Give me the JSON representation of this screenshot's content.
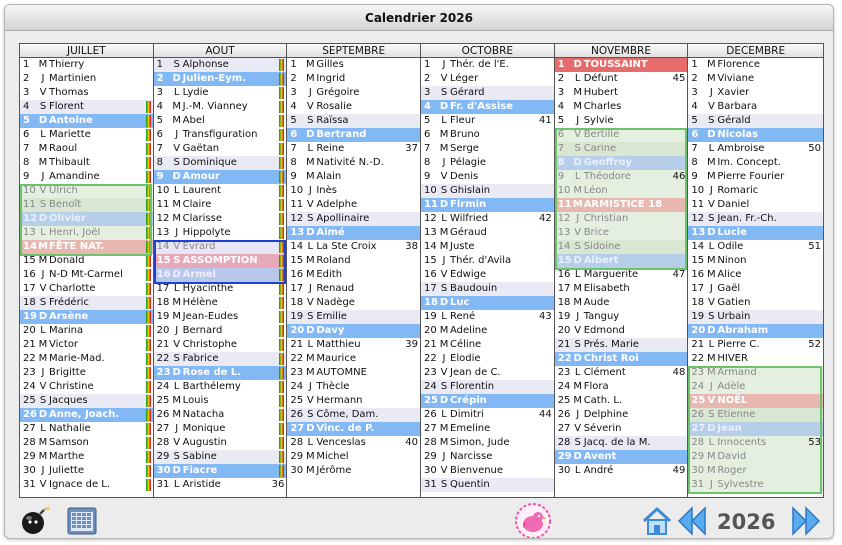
{
  "window": {
    "title": "Calendrier 2026"
  },
  "footer": {
    "year": "2026"
  },
  "icons": {
    "bomb": "bomb-icon",
    "calendar": "calendar-grid-icon",
    "mascot": "pink-bird-mascot-icon",
    "home": "home-icon",
    "prev": "double-chevron-left-icon",
    "next": "double-chevron-right-icon"
  },
  "months": [
    {
      "name": "JUILLET",
      "days": [
        [
          "1",
          "M",
          "Thierry",
          ""
        ],
        [
          "2",
          "J",
          "Martinien",
          ""
        ],
        [
          "3",
          "V",
          "Thomas",
          ""
        ],
        [
          "4",
          "S",
          "Florent",
          ""
        ],
        [
          "5",
          "D",
          "Antoine",
          ""
        ],
        [
          "6",
          "L",
          "Mariette",
          ""
        ],
        [
          "7",
          "M",
          "Raoul",
          ""
        ],
        [
          "8",
          "M",
          "Thibault",
          ""
        ],
        [
          "9",
          "J",
          "Amandine",
          ""
        ],
        [
          "10",
          "V",
          "Ulrich",
          ""
        ],
        [
          "11",
          "S",
          "Benoît",
          ""
        ],
        [
          "12",
          "D",
          "Olivier",
          ""
        ],
        [
          "13",
          "L",
          "Henri, Joël",
          ""
        ],
        [
          "14",
          "M",
          "FÊTE NAT.",
          ""
        ],
        [
          "15",
          "M",
          "Donald",
          ""
        ],
        [
          "16",
          "J",
          "N-D Mt-Carmel",
          ""
        ],
        [
          "17",
          "V",
          "Charlotte",
          ""
        ],
        [
          "18",
          "S",
          "Frédéric",
          ""
        ],
        [
          "19",
          "D",
          "Arsène",
          ""
        ],
        [
          "20",
          "L",
          "Marina",
          ""
        ],
        [
          "21",
          "M",
          "Victor",
          ""
        ],
        [
          "22",
          "M",
          "Marie-Mad.",
          ""
        ],
        [
          "23",
          "J",
          "Brigitte",
          ""
        ],
        [
          "24",
          "V",
          "Christine",
          ""
        ],
        [
          "25",
          "S",
          "Jacques",
          ""
        ],
        [
          "26",
          "D",
          "Anne, Joach.",
          ""
        ],
        [
          "27",
          "L",
          "Nathalie",
          ""
        ],
        [
          "28",
          "M",
          "Samson",
          ""
        ],
        [
          "29",
          "M",
          "Marthe",
          ""
        ],
        [
          "30",
          "J",
          "Juliette",
          ""
        ],
        [
          "31",
          "V",
          "Ignace de L.",
          ""
        ]
      ]
    },
    {
      "name": "AOUT",
      "days": [
        [
          "1",
          "S",
          "Alphonse",
          ""
        ],
        [
          "2",
          "D",
          "Julien-Eym.",
          ""
        ],
        [
          "3",
          "L",
          "Lydie",
          ""
        ],
        [
          "4",
          "M",
          "J.-M. Vianney",
          ""
        ],
        [
          "5",
          "M",
          "Abel",
          ""
        ],
        [
          "6",
          "J",
          "Transfiguration",
          ""
        ],
        [
          "7",
          "V",
          "Gaëtan",
          ""
        ],
        [
          "8",
          "S",
          "Dominique",
          ""
        ],
        [
          "9",
          "D",
          "Amour",
          ""
        ],
        [
          "10",
          "L",
          "Laurent",
          ""
        ],
        [
          "11",
          "M",
          "Claire",
          ""
        ],
        [
          "12",
          "M",
          "Clarisse",
          ""
        ],
        [
          "13",
          "J",
          "Hippolyte",
          ""
        ],
        [
          "14",
          "V",
          "Evrard",
          ""
        ],
        [
          "15",
          "S",
          "ASSOMPTION",
          ""
        ],
        [
          "16",
          "D",
          "Armel",
          ""
        ],
        [
          "17",
          "L",
          "Hyacinthe",
          ""
        ],
        [
          "18",
          "M",
          "Hélène",
          ""
        ],
        [
          "19",
          "M",
          "Jean-Eudes",
          ""
        ],
        [
          "20",
          "J",
          "Bernard",
          ""
        ],
        [
          "21",
          "V",
          "Christophe",
          ""
        ],
        [
          "22",
          "S",
          "Fabrice",
          ""
        ],
        [
          "23",
          "D",
          "Rose de L.",
          ""
        ],
        [
          "24",
          "L",
          "Barthélemy",
          ""
        ],
        [
          "25",
          "M",
          "Louis",
          ""
        ],
        [
          "26",
          "M",
          "Natacha",
          ""
        ],
        [
          "27",
          "J",
          "Monique",
          ""
        ],
        [
          "28",
          "V",
          "Augustin",
          ""
        ],
        [
          "29",
          "S",
          "Sabine",
          ""
        ],
        [
          "30",
          "D",
          "Fiacre",
          ""
        ],
        [
          "31",
          "L",
          "Aristide",
          "36"
        ]
      ]
    },
    {
      "name": "SEPTEMBRE",
      "days": [
        [
          "1",
          "M",
          "Gilles",
          ""
        ],
        [
          "2",
          "M",
          "Ingrid",
          ""
        ],
        [
          "3",
          "J",
          "Grégoire",
          ""
        ],
        [
          "4",
          "V",
          "Rosalie",
          ""
        ],
        [
          "5",
          "S",
          "Raïssa",
          ""
        ],
        [
          "6",
          "D",
          "Bertrand",
          ""
        ],
        [
          "7",
          "L",
          "Reine",
          "37"
        ],
        [
          "8",
          "M",
          "Nativité N.-D.",
          ""
        ],
        [
          "9",
          "M",
          "Alain",
          ""
        ],
        [
          "10",
          "J",
          "Inès",
          ""
        ],
        [
          "11",
          "V",
          "Adelphe",
          ""
        ],
        [
          "12",
          "S",
          "Apollinaire",
          ""
        ],
        [
          "13",
          "D",
          "Aimé",
          ""
        ],
        [
          "14",
          "L",
          "La Ste Croix",
          "38"
        ],
        [
          "15",
          "M",
          "Roland",
          ""
        ],
        [
          "16",
          "M",
          "Edith",
          ""
        ],
        [
          "17",
          "J",
          "Renaud",
          ""
        ],
        [
          "18",
          "V",
          "Nadège",
          ""
        ],
        [
          "19",
          "S",
          "Emilie",
          ""
        ],
        [
          "20",
          "D",
          "Davy",
          ""
        ],
        [
          "21",
          "L",
          "Matthieu",
          "39"
        ],
        [
          "22",
          "M",
          "Maurice",
          ""
        ],
        [
          "23",
          "M",
          "AUTOMNE",
          ""
        ],
        [
          "24",
          "J",
          "Thècle",
          ""
        ],
        [
          "25",
          "V",
          "Hermann",
          ""
        ],
        [
          "26",
          "S",
          "Côme, Dam.",
          ""
        ],
        [
          "27",
          "D",
          "Vinc. de P.",
          ""
        ],
        [
          "28",
          "L",
          "Venceslas",
          "40"
        ],
        [
          "29",
          "M",
          "Michel",
          ""
        ],
        [
          "30",
          "M",
          "Jérôme",
          ""
        ]
      ]
    },
    {
      "name": "OCTOBRE",
      "days": [
        [
          "1",
          "J",
          "Thér. de l'E.",
          ""
        ],
        [
          "2",
          "V",
          "Léger",
          ""
        ],
        [
          "3",
          "S",
          "Gérard",
          ""
        ],
        [
          "4",
          "D",
          "Fr. d'Assise",
          ""
        ],
        [
          "5",
          "L",
          "Fleur",
          "41"
        ],
        [
          "6",
          "M",
          "Bruno",
          ""
        ],
        [
          "7",
          "M",
          "Serge",
          ""
        ],
        [
          "8",
          "J",
          "Pélagie",
          ""
        ],
        [
          "9",
          "V",
          "Denis",
          ""
        ],
        [
          "10",
          "S",
          "Ghislain",
          ""
        ],
        [
          "11",
          "D",
          "Firmin",
          ""
        ],
        [
          "12",
          "L",
          "Wilfried",
          "42"
        ],
        [
          "13",
          "M",
          "Géraud",
          ""
        ],
        [
          "14",
          "M",
          "Juste",
          ""
        ],
        [
          "15",
          "J",
          "Thér. d'Avila",
          ""
        ],
        [
          "16",
          "V",
          "Edwige",
          ""
        ],
        [
          "17",
          "S",
          "Baudouin",
          ""
        ],
        [
          "18",
          "D",
          "Luc",
          ""
        ],
        [
          "19",
          "L",
          "René",
          "43"
        ],
        [
          "20",
          "M",
          "Adeline",
          ""
        ],
        [
          "21",
          "M",
          "Céline",
          ""
        ],
        [
          "22",
          "J",
          "Elodie",
          ""
        ],
        [
          "23",
          "V",
          "Jean de C.",
          ""
        ],
        [
          "24",
          "S",
          "Florentin",
          ""
        ],
        [
          "25",
          "D",
          "Crépin",
          ""
        ],
        [
          "26",
          "L",
          "Dimitri",
          "44"
        ],
        [
          "27",
          "M",
          "Emeline",
          ""
        ],
        [
          "28",
          "M",
          "Simon, Jude",
          ""
        ],
        [
          "29",
          "J",
          "Narcisse",
          ""
        ],
        [
          "30",
          "V",
          "Bienvenue",
          ""
        ],
        [
          "31",
          "S",
          "Quentin",
          ""
        ]
      ]
    },
    {
      "name": "NOVEMBRE",
      "days": [
        [
          "1",
          "D",
          "TOUSSAINT",
          ""
        ],
        [
          "2",
          "L",
          "Défunt",
          "45"
        ],
        [
          "3",
          "M",
          "Hubert",
          ""
        ],
        [
          "4",
          "M",
          "Charles",
          ""
        ],
        [
          "5",
          "J",
          "Sylvie",
          ""
        ],
        [
          "6",
          "V",
          "Bertille",
          ""
        ],
        [
          "7",
          "S",
          "Carine",
          ""
        ],
        [
          "8",
          "D",
          "Geoffroy",
          ""
        ],
        [
          "9",
          "L",
          "Théodore",
          "46"
        ],
        [
          "10",
          "M",
          "Léon",
          ""
        ],
        [
          "11",
          "M",
          "ARMISTICE 18",
          ""
        ],
        [
          "12",
          "J",
          "Christian",
          ""
        ],
        [
          "13",
          "V",
          "Brice",
          ""
        ],
        [
          "14",
          "S",
          "Sidoine",
          ""
        ],
        [
          "15",
          "D",
          "Albert",
          ""
        ],
        [
          "16",
          "L",
          "Marguerite",
          "47"
        ],
        [
          "17",
          "M",
          "Elisabeth",
          ""
        ],
        [
          "18",
          "M",
          "Aude",
          ""
        ],
        [
          "19",
          "J",
          "Tanguy",
          ""
        ],
        [
          "20",
          "V",
          "Edmond",
          ""
        ],
        [
          "21",
          "S",
          "Prés. Marie",
          ""
        ],
        [
          "22",
          "D",
          "Christ Roi",
          ""
        ],
        [
          "23",
          "L",
          "Clément",
          "48"
        ],
        [
          "24",
          "M",
          "Flora",
          ""
        ],
        [
          "25",
          "M",
          "Cath. L.",
          ""
        ],
        [
          "26",
          "J",
          "Delphine",
          ""
        ],
        [
          "27",
          "V",
          "Séverin",
          ""
        ],
        [
          "28",
          "S",
          "Jacq. de la M.",
          ""
        ],
        [
          "29",
          "D",
          "Avent",
          ""
        ],
        [
          "30",
          "L",
          "André",
          "49"
        ]
      ]
    },
    {
      "name": "DECEMBRE",
      "days": [
        [
          "1",
          "M",
          "Florence",
          ""
        ],
        [
          "2",
          "M",
          "Viviane",
          ""
        ],
        [
          "3",
          "J",
          "Xavier",
          ""
        ],
        [
          "4",
          "V",
          "Barbara",
          ""
        ],
        [
          "5",
          "S",
          "Gérald",
          ""
        ],
        [
          "6",
          "D",
          "Nicolas",
          ""
        ],
        [
          "7",
          "L",
          "Ambroise",
          "50"
        ],
        [
          "8",
          "M",
          "Im. Concept.",
          ""
        ],
        [
          "9",
          "M",
          "Pierre Fourier",
          ""
        ],
        [
          "10",
          "J",
          "Romaric",
          ""
        ],
        [
          "11",
          "V",
          "Daniel",
          ""
        ],
        [
          "12",
          "S",
          "Jean. Fr.-Ch.",
          ""
        ],
        [
          "13",
          "D",
          "Lucie",
          ""
        ],
        [
          "14",
          "L",
          "Odile",
          "51"
        ],
        [
          "15",
          "M",
          "Ninon",
          ""
        ],
        [
          "16",
          "M",
          "Alice",
          ""
        ],
        [
          "17",
          "J",
          "Gaël",
          ""
        ],
        [
          "18",
          "V",
          "Gatien",
          ""
        ],
        [
          "19",
          "S",
          "Urbain",
          ""
        ],
        [
          "20",
          "D",
          "Abraham",
          ""
        ],
        [
          "21",
          "L",
          "Pierre C.",
          "52"
        ],
        [
          "22",
          "M",
          "HIVER",
          ""
        ],
        [
          "23",
          "M",
          "Armand",
          ""
        ],
        [
          "24",
          "J",
          "Adèle",
          ""
        ],
        [
          "25",
          "V",
          "NOËL",
          ""
        ],
        [
          "26",
          "S",
          "Etienne",
          ""
        ],
        [
          "27",
          "D",
          "Jean",
          ""
        ],
        [
          "28",
          "L",
          "Innocents",
          "53"
        ],
        [
          "29",
          "M",
          "David",
          ""
        ],
        [
          "30",
          "M",
          "Roger",
          ""
        ],
        [
          "31",
          "J",
          "Sylvestre",
          ""
        ]
      ]
    }
  ]
}
